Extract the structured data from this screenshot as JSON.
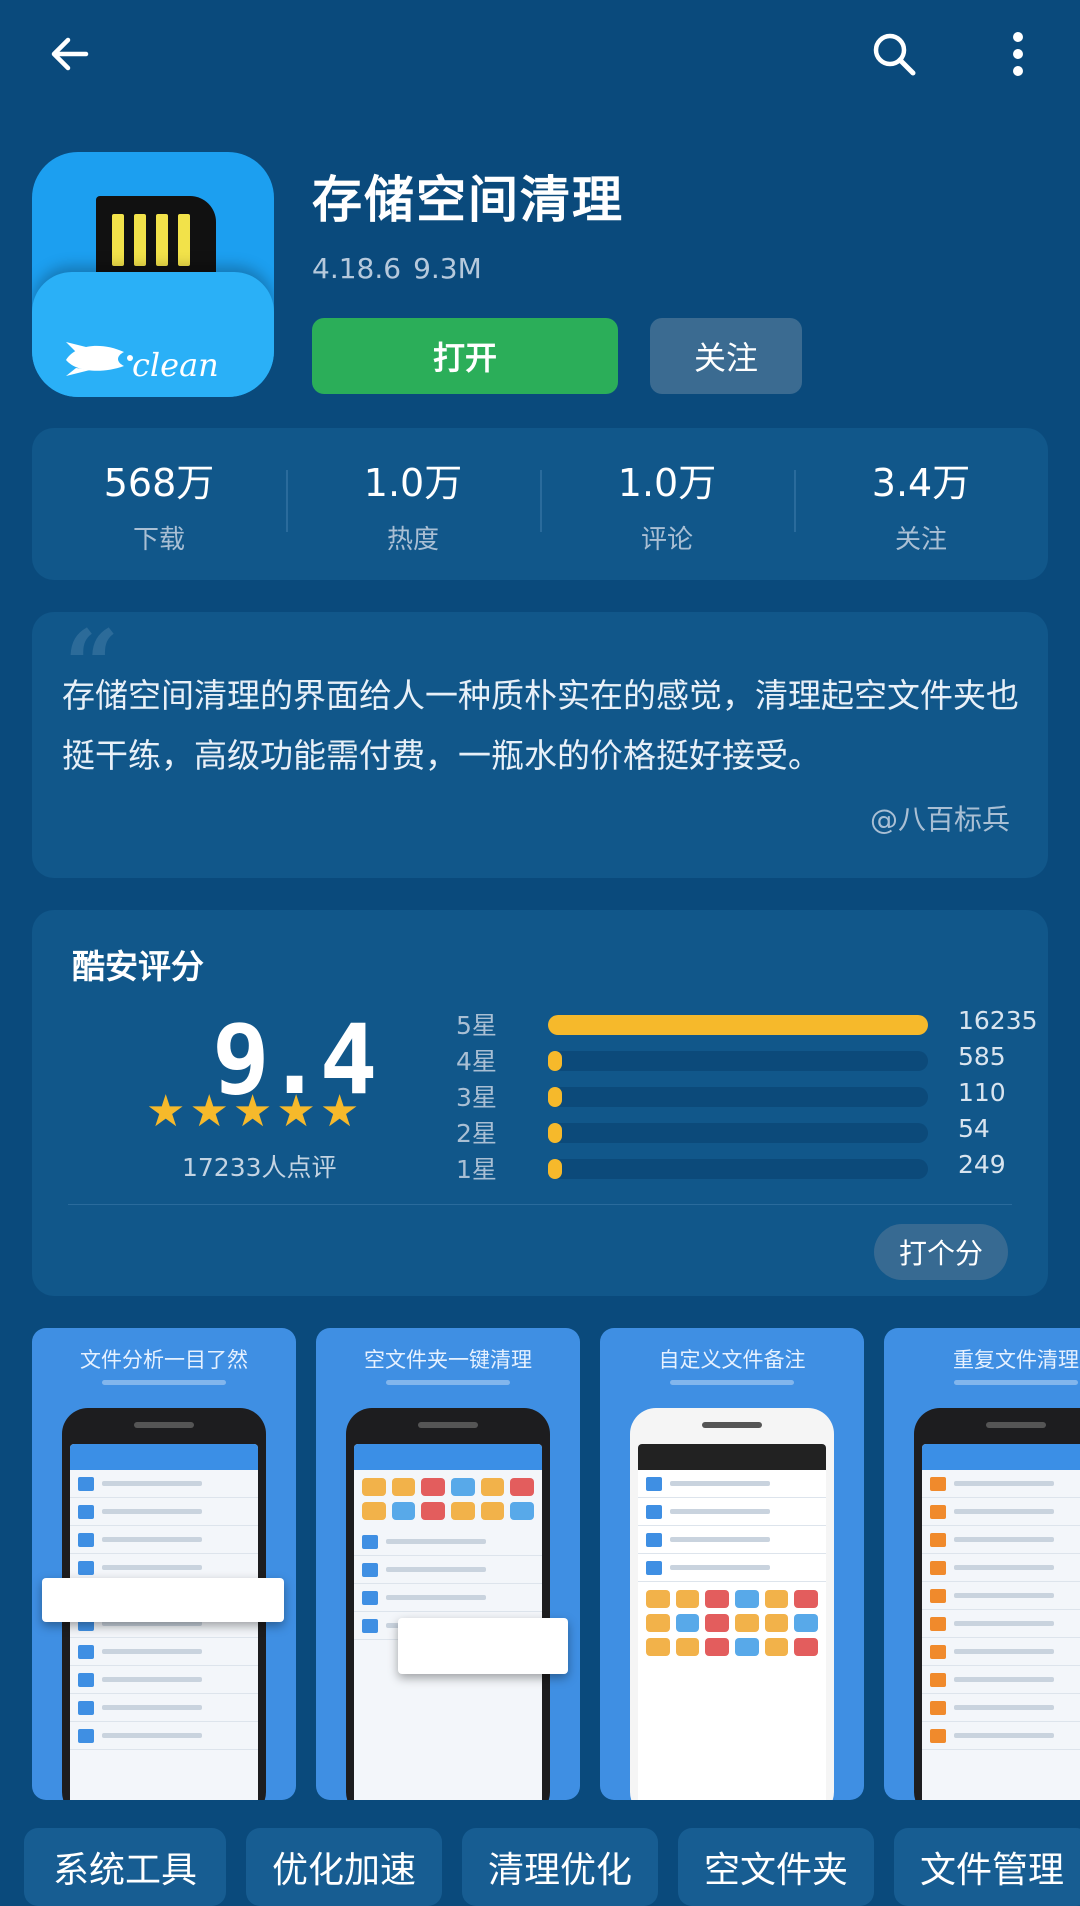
{
  "toolbar": {
    "back_icon": "arrow-left-icon",
    "search_icon": "search-icon",
    "more_icon": "more-vertical-icon"
  },
  "app": {
    "icon_brand": "clean",
    "title": "存储空间清理",
    "version": "4.18.6",
    "size": "9.3M",
    "open_label": "打开",
    "follow_label": "关注"
  },
  "stats": [
    {
      "value": "568万",
      "label": "下载"
    },
    {
      "value": "1.0万",
      "label": "热度"
    },
    {
      "value": "1.0万",
      "label": "评论"
    },
    {
      "value": "3.4万",
      "label": "关注"
    }
  ],
  "quote": {
    "mark": "“",
    "text": "存储空间清理的界面给人一种质朴实在的感觉，清理起空文件夹也挺干练，高级功能需付费，一瓶水的价格挺好接受。",
    "author": "@八百标兵"
  },
  "rating": {
    "title": "酷安评分",
    "score": "9.4",
    "stars": 5,
    "count_label": "17233人点评",
    "rate_button": "打个分",
    "rows": [
      {
        "label": "5星",
        "count": "16235",
        "fraction": 1.0
      },
      {
        "label": "4星",
        "count": "585",
        "fraction": 0.036
      },
      {
        "label": "3星",
        "count": "110",
        "fraction": 0.007
      },
      {
        "label": "2星",
        "count": "54",
        "fraction": 0.003
      },
      {
        "label": "1星",
        "count": "249",
        "fraction": 0.015
      }
    ]
  },
  "screenshots": [
    {
      "caption": "文件分析一目了然"
    },
    {
      "caption": "空文件夹一键清理"
    },
    {
      "caption": "自定义文件备注"
    },
    {
      "caption": "重复文件清理"
    }
  ],
  "tags": [
    "系统工具",
    "优化加速",
    "清理优化",
    "空文件夹",
    "文件管理"
  ],
  "colors": {
    "background": "#0a4a7c",
    "card": "#11578a",
    "open_button": "#2bae59",
    "star": "#f6b92b"
  }
}
